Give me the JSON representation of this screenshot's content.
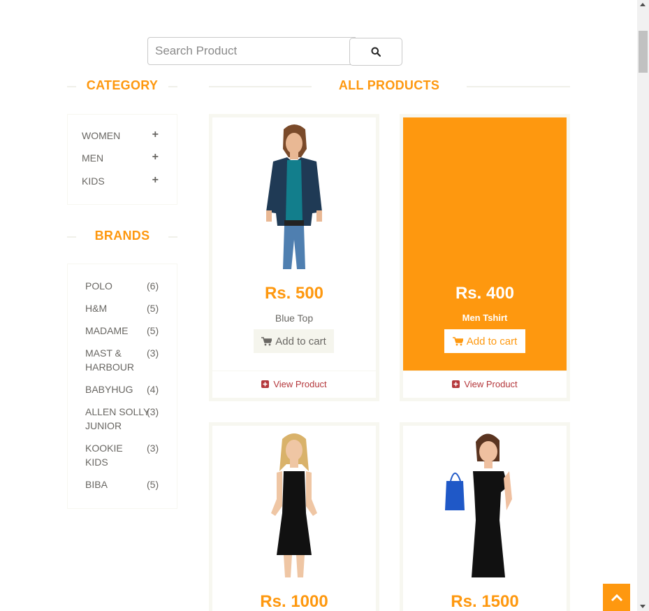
{
  "search": {
    "placeholder": "Search Product",
    "value": ""
  },
  "sidebar": {
    "category_title": "CATEGORY",
    "categories": [
      {
        "label": "WOMEN"
      },
      {
        "label": "MEN"
      },
      {
        "label": "KIDS"
      }
    ],
    "brands_title": "BRANDS",
    "brands": [
      {
        "name": "POLO",
        "count": "(6)"
      },
      {
        "name": "H&M",
        "count": "(5)"
      },
      {
        "name": "MADAME",
        "count": "(5)"
      },
      {
        "name": "MAST & HARBOUR",
        "count": "(3)"
      },
      {
        "name": "BABYHUG",
        "count": "(4)"
      },
      {
        "name": "ALLEN SOLLY JUNIOR",
        "count": "(3)"
      },
      {
        "name": "KOOKIE KIDS",
        "count": "(3)"
      },
      {
        "name": "BIBA",
        "count": "(5)"
      }
    ]
  },
  "main": {
    "title": "ALL PRODUCTS",
    "products": [
      {
        "price": "Rs. 500",
        "name": "Blue Top",
        "cart_label": "Add to cart",
        "view_label": "View Product"
      },
      {
        "price": "Rs. 400",
        "name": "Men Tshirt",
        "cart_label": "Add to cart",
        "view_label": "View Product"
      },
      {
        "price": "Rs. 1000",
        "name": "",
        "cart_label": "",
        "view_label": ""
      },
      {
        "price": "Rs. 1500",
        "name": "",
        "cart_label": "",
        "view_label": ""
      }
    ]
  },
  "colors": {
    "accent": "#fe980f",
    "view_link": "#b4373b",
    "text": "#696763"
  }
}
